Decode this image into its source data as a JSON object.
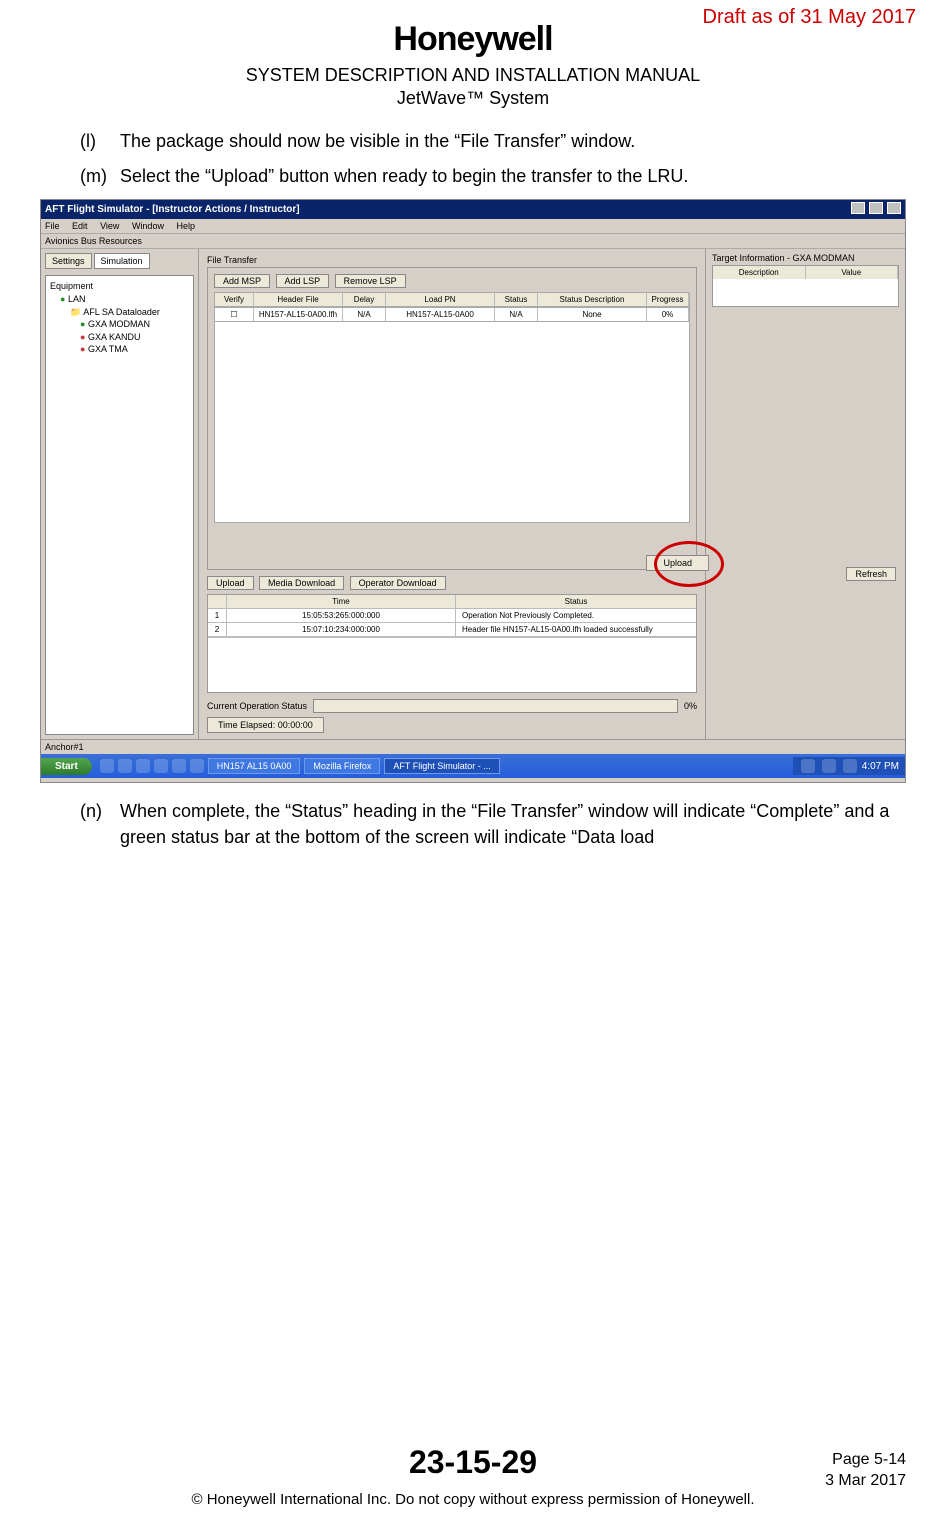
{
  "header": {
    "draft": "Draft as of 31 May 2017",
    "logo": "Honeywell",
    "title": "SYSTEM DESCRIPTION AND INSTALLATION MANUAL",
    "subtitle": "JetWave™ System"
  },
  "steps": {
    "l": {
      "label": "(l)",
      "text": "The package should now be visible in the “File Transfer” window."
    },
    "m": {
      "label": "(m)",
      "text": "Select the “Upload” button when ready to begin the transfer to the LRU."
    },
    "n": {
      "label": "(n)",
      "text": "When complete, the “Status” heading in the “File Transfer” window will indicate “Complete” and a green status bar at the bottom of the screen will indicate “Data load"
    }
  },
  "shot": {
    "title": "AFT Flight Simulator - [Instructor Actions / Instructor]",
    "menus": [
      "File",
      "Edit",
      "View",
      "Window",
      "Help"
    ],
    "subbar": "Avionics Bus Resources",
    "leftTabs": {
      "settings": "Settings",
      "simulation": "Simulation"
    },
    "tree": {
      "root": "Equipment",
      "lan": "LAN",
      "folder": "AFL SA Dataloader",
      "items": [
        "GXA MODMAN",
        "GXA KANDU",
        "GXA TMA"
      ]
    },
    "fileTransferLabel": "File Transfer",
    "ftButtons": {
      "addMsp": "Add MSP",
      "addLsp": "Add LSP",
      "removeLsp": "Remove LSP"
    },
    "ftHeaders": {
      "verify": "Verify",
      "headerFile": "Header File",
      "delay": "Delay",
      "loadPn": "Load PN",
      "status": "Status",
      "statusDesc": "Status Description",
      "progress": "Progress"
    },
    "ftRow": {
      "verify": "",
      "headerFile": "HN157-AL15-0A00.lfh",
      "delay": "N/A",
      "loadPn": "HN157-AL15-0A00",
      "status": "N/A",
      "statusDesc": "None",
      "progress": "0%"
    },
    "uploadBtn": "Upload",
    "bottomTabs": {
      "upload": "Upload",
      "mediaDownload": "Media Download",
      "operatorDownload": "Operator Download"
    },
    "statusHeaders": {
      "time": "Time",
      "status": "Status"
    },
    "statusRows": [
      {
        "idx": "1",
        "time": "15:05:53:265:000:000",
        "status": "Operation Not Previously Completed."
      },
      {
        "idx": "2",
        "time": "15:07:10:234:000:000",
        "status": "Header file HN157-AL15-0A00.lfh loaded successfully"
      }
    ],
    "opStatusLabel": "Current Operation Status",
    "opStatusPct": "0%",
    "timeElapsedLabel": "Time Elapsed:  00:00:00",
    "targetInfo": {
      "title": "Target Information - GXA MODMAN",
      "cols": {
        "desc": "Description",
        "value": "Value"
      }
    },
    "refreshBtn": "Refresh",
    "anchor": "Anchor#1",
    "taskbar": {
      "start": "Start",
      "tasks": [
        "HN157 AL15 0A00",
        "Mozilla Firefox",
        "AFT Flight Simulator - ..."
      ],
      "clock": "4:07 PM"
    }
  },
  "footer": {
    "docnum": "23-15-29",
    "page": "Page 5-14",
    "date": "3 Mar 2017",
    "copyright": "© Honeywell International Inc. Do not copy without express permission of Honeywell."
  }
}
